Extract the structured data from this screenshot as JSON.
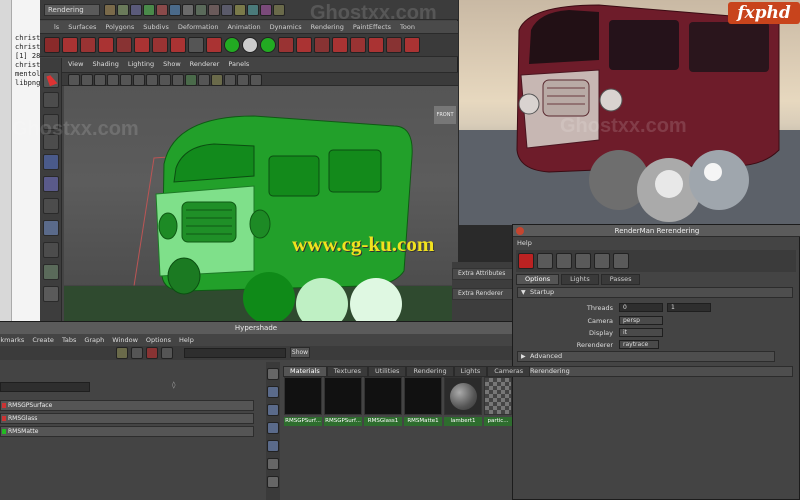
{
  "terminal": {
    "lines": [
      "christo",
      "christo",
      "[1] 28",
      "christo",
      "mentol",
      "libpng"
    ]
  },
  "maya": {
    "mode": "Rendering",
    "shelf_tabs": [
      "ls",
      "Surfaces",
      "Polygons",
      "Subdivs",
      "Deformation",
      "Animation",
      "Dynamics",
      "Rendering",
      "PaintEffects",
      "Toon"
    ],
    "viewport_menu": [
      "View",
      "Shading",
      "Lighting",
      "Show",
      "Renderer",
      "Panels"
    ],
    "viewcube": "FRONT",
    "attr_strips": [
      "Extra Attributes",
      "Extra Renderer"
    ]
  },
  "watermarks": [
    "Ghostxx.com",
    "www.cg-ku.com"
  ],
  "logo": "fxphd",
  "rman": {
    "title": "RenderMan Rerendering",
    "help": "Help",
    "tabs": [
      "Options",
      "Lights",
      "Passes"
    ],
    "sections": {
      "startup": "Startup",
      "advanced": "Advanced",
      "rendering": "Rerendering"
    },
    "fields": {
      "threads_label": "Threads",
      "threads_a": "0",
      "threads_b": "1",
      "camera_label": "Camera",
      "camera": "persp",
      "display_label": "Display",
      "display": "it",
      "rerenderer_label": "Rerenderer",
      "rerenderer": "raytrace"
    }
  },
  "hyper": {
    "title": "Hypershade",
    "menu": [
      "Bookmarks",
      "Create",
      "Tabs",
      "Graph",
      "Window",
      "Options",
      "Help"
    ],
    "show_label": "Show",
    "nodes": [
      {
        "label": "RMSGPSurface",
        "color": "#c33"
      },
      {
        "label": "RMSGlass",
        "color": "#c33"
      },
      {
        "label": "RMSMatte",
        "color": "#2b2"
      }
    ],
    "tabs": [
      "Materials",
      "Textures",
      "Utilities",
      "Rendering",
      "Lights",
      "Cameras"
    ],
    "swatches": [
      "RMSGPSurf...",
      "RMSGPSurf...",
      "RMSGlass1",
      "RMSMatte1",
      "lambert1",
      "partic..."
    ]
  }
}
